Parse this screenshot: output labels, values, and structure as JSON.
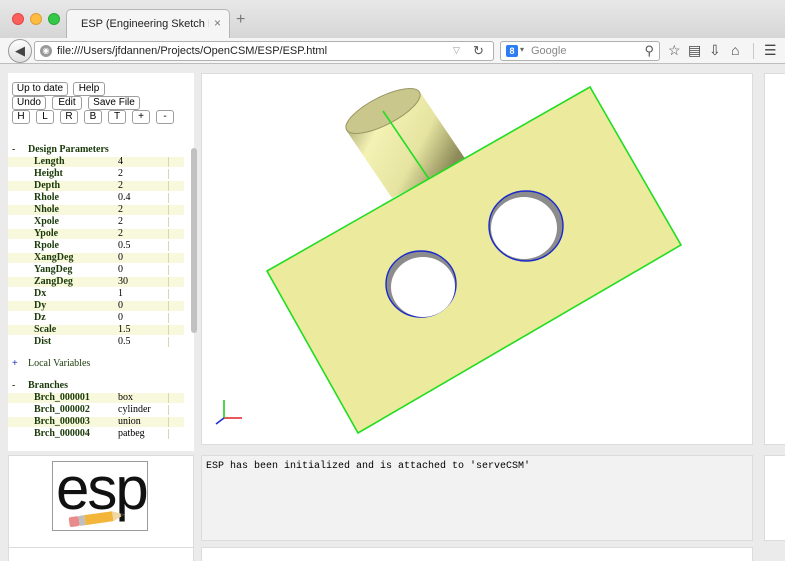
{
  "browser": {
    "tab_title": "ESP (Engineering Sketch Pad, V...",
    "tab_close": "×",
    "new_tab": "+",
    "url": "file:///Users/jfdannen/Projects/OpenCSM/ESP/ESP.html",
    "search_engine_letter": "8",
    "search_placeholder": "Google"
  },
  "toolbar": {
    "up_to_date": "Up to date",
    "help": "Help",
    "undo": "Undo",
    "edit": "Edit",
    "save_file": "Save File",
    "view_h": "H",
    "view_l": "L",
    "view_r": "R",
    "view_b": "B",
    "view_t": "T",
    "zoom_in": "+",
    "zoom_out": "-"
  },
  "tree": {
    "design_parameters": {
      "toggle": "-",
      "label": "Design Parameters",
      "items": [
        {
          "name": "Length",
          "value": "4"
        },
        {
          "name": "Height",
          "value": "2"
        },
        {
          "name": "Depth",
          "value": "2"
        },
        {
          "name": "Rhole",
          "value": "0.4"
        },
        {
          "name": "Nhole",
          "value": "2"
        },
        {
          "name": "Xpole",
          "value": "2"
        },
        {
          "name": "Ypole",
          "value": "2"
        },
        {
          "name": "Rpole",
          "value": "0.5"
        },
        {
          "name": "XangDeg",
          "value": "0"
        },
        {
          "name": "YangDeg",
          "value": "0"
        },
        {
          "name": "ZangDeg",
          "value": "30"
        },
        {
          "name": "Dx",
          "value": "1"
        },
        {
          "name": "Dy",
          "value": "0"
        },
        {
          "name": "Dz",
          "value": "0"
        },
        {
          "name": "Scale",
          "value": "1.5"
        },
        {
          "name": "Dist",
          "value": "0.5"
        }
      ]
    },
    "local_variables": {
      "toggle": "+",
      "label": "Local Variables"
    },
    "branches": {
      "toggle": "-",
      "label": "Branches",
      "items": [
        {
          "name": "Brch_000001",
          "value": "box"
        },
        {
          "name": "Brch_000002",
          "value": "cylinder"
        },
        {
          "name": "Brch_000003",
          "value": "union"
        },
        {
          "name": "Brch_000004",
          "value": "patbeg"
        }
      ]
    }
  },
  "logo": {
    "text": "esp"
  },
  "console": {
    "message": "ESP has been initialized and is attached to 'serveCSM'"
  },
  "colors": {
    "model_face": "#ecea9c",
    "model_edge": "#22dd22",
    "hole_edge": "#1a2acc",
    "tree_shade": "#f8f8dc",
    "tree_label": "#1a3a0a"
  }
}
